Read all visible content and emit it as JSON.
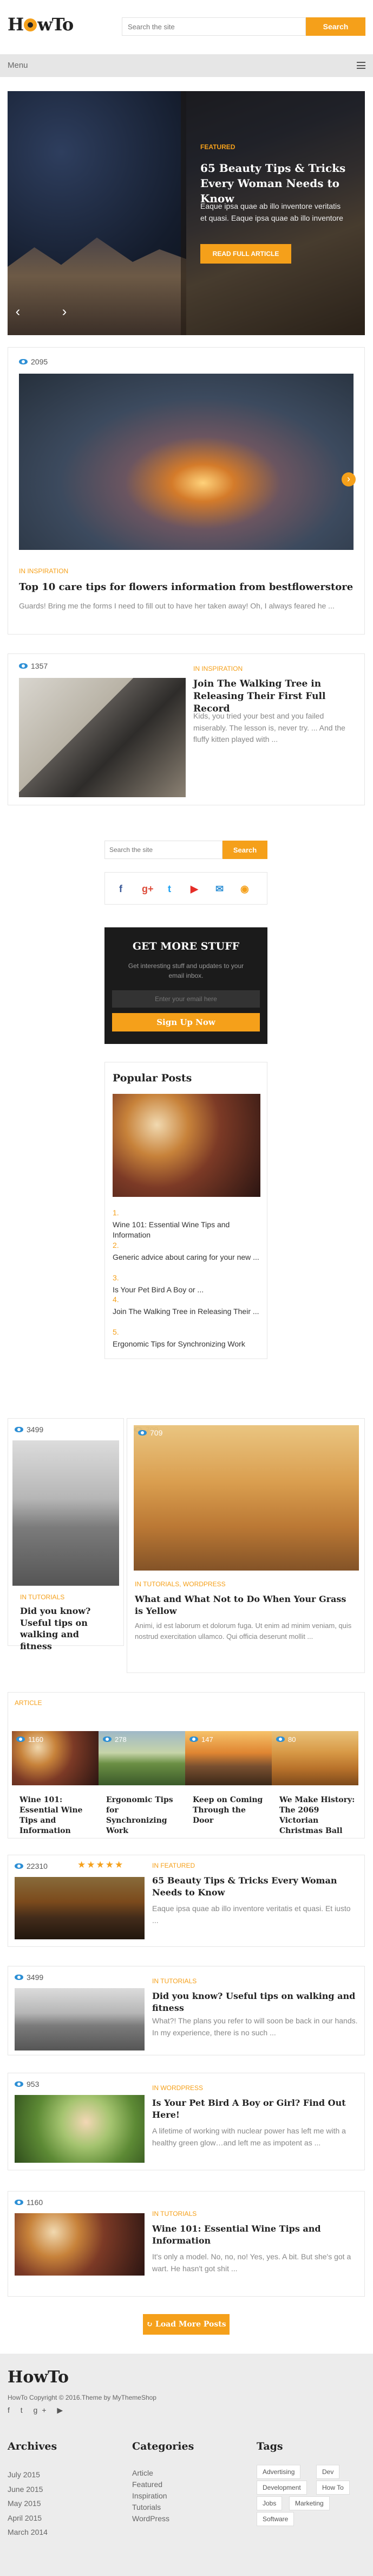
{
  "header": {
    "logo": "HowTo",
    "search_placeholder": "Search the site",
    "search_button": "Search"
  },
  "menubar": {
    "label": "Menu"
  },
  "slider": {
    "category": "FEATURED",
    "title": "65 Beauty Tips & Tricks Every Woman Needs to Know",
    "excerpt": "Eaque ipsa quae ab illo inventore veritatis et quasi. Eaque ipsa quae ab illo inventore",
    "button": "READ FULL ARTICLE",
    "prev": "‹",
    "next": "›"
  },
  "posts": {
    "clouds": {
      "views": "2095",
      "category": "IN INSPIRATION",
      "title": "Top 10 care tips for flowers information from bestflowerstore",
      "excerpt": "Guards! Bring me the forms I need to fill out to have her taken away! Oh, I always feared he ..."
    },
    "laptop": {
      "views": "1357",
      "category": "IN INSPIRATION",
      "title": "Join The Walking Tree in Releasing Their First Full Record",
      "excerpt": "Kids, you tried your best and you failed miserably. The lesson is, never try. ... And the fluffy kitten played with ..."
    },
    "street": {
      "views": "3499",
      "category": "IN TUTORIALS",
      "title": "Did you know? Useful tips on walking and fitness"
    },
    "wheat": {
      "views": "709",
      "category": "IN TUTORIALS, WORDPRESS",
      "title": "What and What Not to Do When Your Grass is Yellow",
      "excerpt": "Animi, id est laborum et dolorum fuga. Ut enim ad minim veniam, quis nostrud exercitation ullamco. Qui officia deserunt mollit ..."
    }
  },
  "widgets": {
    "search_placeholder": "Search the site",
    "search_button": "Search",
    "social": [
      "f",
      "g+",
      "t",
      "▶",
      "✉",
      "◉"
    ],
    "newsletter": {
      "title": "GET MORE STUFF",
      "text": "Get interesting stuff and updates to your email inbox.",
      "placeholder": "Enter your email here",
      "button": "Sign Up Now"
    },
    "popular": {
      "title": "Popular Posts",
      "items": [
        {
          "num": "1.",
          "title": "Wine 101: Essential Wine Tips and Information"
        },
        {
          "num": "2.",
          "title": "Generic advice about caring for your new ..."
        },
        {
          "num": "3.",
          "title": "Is Your Pet Bird A Boy or ..."
        },
        {
          "num": "4.",
          "title": "Join The Walking Tree in Releasing Their ..."
        },
        {
          "num": "5.",
          "title": "Ergonomic Tips for Synchronizing Work"
        }
      ]
    }
  },
  "article_section": {
    "label": "ARTICLE",
    "cards": [
      {
        "views": "1160",
        "title": "Wine 101: Essential Wine Tips and Information"
      },
      {
        "views": "278",
        "title": "Ergonomic Tips for Synchronizing Work"
      },
      {
        "views": "147",
        "title": "Keep on Coming Through the Door"
      },
      {
        "views": "80",
        "title": "We Make History: The 2069 Victorian Christmas Ball"
      }
    ]
  },
  "list_posts": [
    {
      "views": "22310",
      "stars": "★★★★★",
      "category": "IN FEATURED",
      "title": "65 Beauty Tips & Tricks Every Woman Needs to Know",
      "excerpt": "Eaque ipsa quae ab illo inventore veritatis et quasi. Et iusto ..."
    },
    {
      "views": "3499",
      "category": "IN TUTORIALS",
      "title": "Did you know? Useful tips on walking and fitness",
      "excerpt": "What?! The plans you refer to will soon be back in our hands. In my experience, there is no such ..."
    },
    {
      "views": "953",
      "category": "IN WORDPRESS",
      "title": "Is Your Pet Bird A Boy or Girl? Find Out Here!",
      "excerpt": "A lifetime of working with nuclear power has left me with a healthy green glow…and left me as impotent as ..."
    },
    {
      "views": "1160",
      "category": "IN TUTORIALS",
      "title": "Wine 101: Essential Wine Tips and Information",
      "excerpt": "It's only a model. No, no, no! Yes, yes. A bit. But she's got a wart. He hasn't got shit ..."
    }
  ],
  "load_more": "↻ Load More Posts",
  "footer": {
    "logo": "HowTo",
    "copyright": "HowTo Copyright © 2016.Theme by MyThemeShop",
    "social": "f t g+ ▶",
    "archives": {
      "title": "Archives",
      "items": [
        "July 2015",
        "June 2015",
        "May 2015",
        "April 2015",
        "March 2014"
      ]
    },
    "categories": {
      "title": "Categories",
      "items": [
        "Article",
        "Featured",
        "Inspiration",
        "Tutorials",
        "WordPress"
      ]
    },
    "tags": {
      "title": "Tags",
      "items": [
        "Advertising",
        "Dev",
        "Development",
        "How To",
        "Jobs",
        "Marketing",
        "Software"
      ]
    }
  },
  "colors": {
    "accent": "#f5a01a",
    "eye": "#2d8fd5",
    "footer_bg": "#ececec"
  }
}
